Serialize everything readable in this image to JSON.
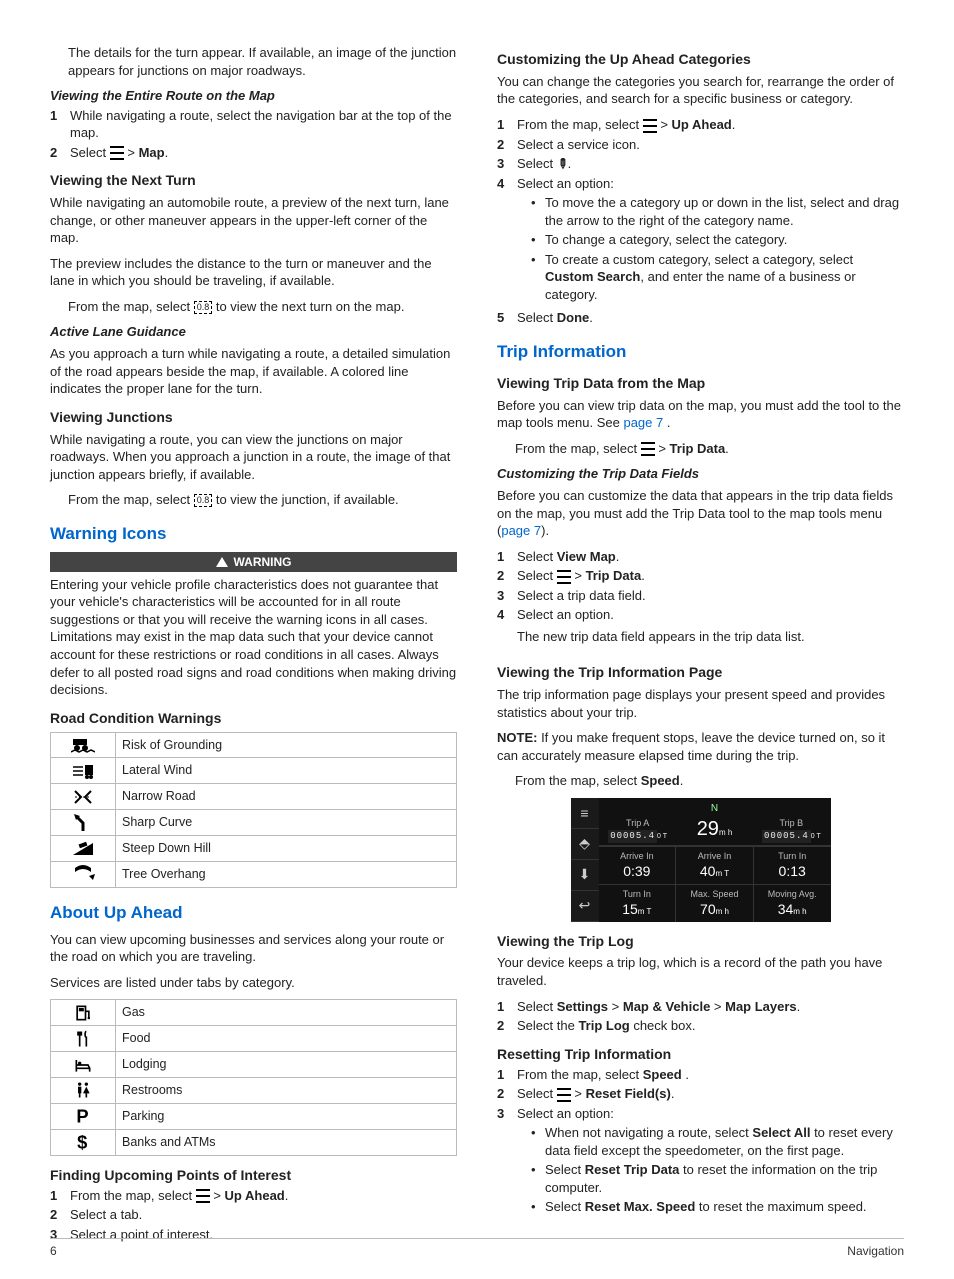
{
  "footer": {
    "page": "6",
    "section": "Navigation"
  },
  "left": {
    "intro": "The details for the turn appear. If available, an image of the junction appears for junctions on major roadways.",
    "entireRoute": {
      "title": "Viewing the Entire Route on the Map",
      "s1": "While navigating a route, select the navigation bar at the top of the map.",
      "s2a": "Select ",
      "s2b": " > ",
      "s2c": "Map",
      "s2d": "."
    },
    "nextTurn": {
      "title": "Viewing the Next Turn",
      "p1": "While navigating an automobile route, a preview of the next turn, lane change, or other maneuver appears in the upper-left corner of the map.",
      "p2": "The preview includes the distance to the turn or maneuver and the lane in which you should be traveling, if available.",
      "p3a": "From the map, select ",
      "p3b": " to view the next turn on the map.",
      "nextIcon": "0.8"
    },
    "activeLane": {
      "title": "Active Lane Guidance",
      "p": "As you approach a turn while navigating a route, a detailed simulation of the road appears beside the map, if available. A colored line indicates the proper lane for the turn."
    },
    "junctions": {
      "title": "Viewing Junctions",
      "p1": "While navigating a route, you can view the junctions on major roadways. When you approach a junction in a route, the image of that junction appears briefly, if available.",
      "p2a": "From the map, select ",
      "p2b": " to view the junction, if available."
    },
    "warnIcons": {
      "title": "Warning Icons",
      "bar": "WARNING",
      "p": "Entering your vehicle profile characteristics does not guarantee that your vehicle's characteristics will be accounted for in all route suggestions or that you will receive the warning icons in all cases. Limitations may exist in the map data such that your device cannot account for these restrictions or road conditions in all cases. Always defer to all posted road signs and road conditions when making driving decisions.",
      "roadTitle": "Road Condition Warnings",
      "rows": [
        {
          "icon": "grounding",
          "label": "Risk of Grounding"
        },
        {
          "icon": "wind",
          "label": "Lateral Wind"
        },
        {
          "icon": "narrow",
          "label": "Narrow Road"
        },
        {
          "icon": "curve",
          "label": "Sharp Curve"
        },
        {
          "icon": "downhill",
          "label": "Steep Down Hill"
        },
        {
          "icon": "tree",
          "label": "Tree Overhang"
        }
      ]
    },
    "upAhead": {
      "title": "About Up Ahead",
      "p1": "You can view upcoming businesses and services along your route or the road on which you are traveling.",
      "p2": "Services are listed under tabs by category.",
      "rows": [
        {
          "icon": "gas",
          "label": "Gas"
        },
        {
          "icon": "food",
          "label": "Food"
        },
        {
          "icon": "lodging",
          "label": "Lodging"
        },
        {
          "icon": "restrooms",
          "label": "Restrooms"
        },
        {
          "icon": "parking",
          "label": "Parking"
        },
        {
          "icon": "banks",
          "label": "Banks and ATMs"
        }
      ],
      "findTitle": "Finding Upcoming Points of Interest",
      "f1a": "From the map, select ",
      "f1b": " > ",
      "f1c": "Up Ahead",
      "f1d": ".",
      "f2": "Select a tab.",
      "f3": "Select a point of interest."
    }
  },
  "right": {
    "custom": {
      "title": "Customizing the Up Ahead Categories",
      "p": "You can change the categories you search for, rearrange the order of the categories, and search for a specific business or category.",
      "s1a": "From the map, select ",
      "s1b": " > ",
      "s1c": "Up Ahead",
      "s1d": ".",
      "s2": "Select a service icon.",
      "s3a": "Select ",
      "s3b": ".",
      "s4": "Select an option:",
      "b1": "To move the a category up or down in the list, select and drag the arrow to the right of the category name.",
      "b2": "To change a category, select the category.",
      "b3a": "To create a custom category, select a category, select ",
      "b3b": "Custom Search",
      "b3c": ", and enter the name of a business or category.",
      "s5a": "Select ",
      "s5b": "Done",
      "s5c": "."
    },
    "tripInfo": {
      "title": "Trip Information",
      "viewMapTitle": "Viewing Trip Data from the Map",
      "vm1a": "Before you can view trip data on the map, you must add the tool to the map tools menu. See ",
      "vm1link": "page 7",
      "vm1b": " .",
      "vm2a": "From the map, select ",
      "vm2b": " > ",
      "vm2c": "Trip Data",
      "vm2d": ".",
      "custFields": {
        "title": "Customizing the Trip Data Fields",
        "p1a": "Before you can customize the data that appears in the trip data fields on the map, you must add the Trip Data tool to the map tools menu (",
        "p1link": "page 7",
        "p1b": ").",
        "s1a": "Select ",
        "s1b": "View Map",
        "s1c": ".",
        "s2a": "Select ",
        "s2b": " > ",
        "s2c": "Trip Data",
        "s2d": ".",
        "s3": "Select a trip data field.",
        "s4": "Select an option.",
        "after": "The new trip data field appears in the trip data list."
      },
      "infoPage": {
        "title": "Viewing the Trip Information Page",
        "p1": "The trip information page displays your present speed and provides statistics about your trip.",
        "noteA": "NOTE:",
        "noteB": " If you make frequent stops, leave the device turned on, so it can accurately measure elapsed time during the trip.",
        "p2a": "From the map, select ",
        "p2b": "Speed",
        "p2c": ".",
        "mock": {
          "compass": "N",
          "speed": "29",
          "speedUnit": "m h",
          "tripA": "Trip A",
          "odoA": "00005.4",
          "odoAunit": "0 T",
          "tripB": "Trip B",
          "odoB": "00005.4",
          "odoBunit": "0 T",
          "r1": [
            {
              "lbl": "Arrive In",
              "val": "0:39"
            },
            {
              "lbl": "Arrive In",
              "val": "40",
              "u": "m T"
            },
            {
              "lbl": "Turn In",
              "val": "0:13"
            }
          ],
          "r2": [
            {
              "lbl": "Turn In",
              "val": "15",
              "u": "m T"
            },
            {
              "lbl": "Max. Speed",
              "val": "70",
              "u": "m h"
            },
            {
              "lbl": "Moving Avg.",
              "val": "34",
              "u": "m h"
            }
          ]
        }
      },
      "tripLog": {
        "title": "Viewing the Trip Log",
        "p": "Your device keeps a trip log, which is a record of the path you have traveled.",
        "s1a": "Select ",
        "s1b": "Settings",
        "s1c": " > ",
        "s1d": "Map & Vehicle",
        "s1e": " > ",
        "s1f": "Map Layers",
        "s1g": ".",
        "s2a": "Select the ",
        "s2b": "Trip Log",
        "s2c": " check box."
      },
      "reset": {
        "title": "Resetting Trip Information",
        "s1a": "From the map, select ",
        "s1b": "Speed",
        "s1c": " .",
        "s2a": "Select ",
        "s2b": " > ",
        "s2c": "Reset Field(s)",
        "s2d": ".",
        "s3": "Select an option:",
        "b1a": "When not navigating a route, select ",
        "b1b": "Select All",
        "b1c": " to reset every data field except the speedometer, on the first page.",
        "b2a": "Select ",
        "b2b": "Reset Trip Data",
        "b2c": " to reset the information on the trip computer.",
        "b3a": "Select ",
        "b3b": "Reset Max. Speed",
        "b3c": " to reset the maximum speed."
      }
    }
  }
}
